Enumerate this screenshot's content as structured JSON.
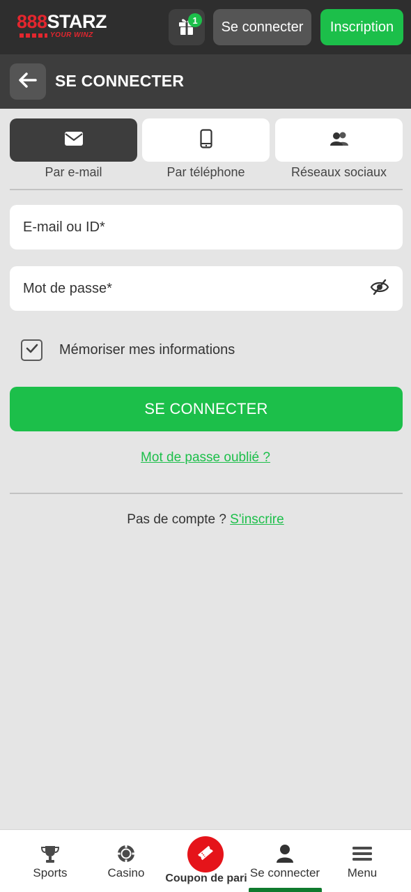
{
  "colors": {
    "accent_green": "#1cbf4a",
    "brand_red": "#e3262e",
    "coupon_red": "#e5141a",
    "topbar_bg": "#2e2e2e",
    "header_bg": "#3d3d3d",
    "page_bg": "#e5e5e5"
  },
  "topbar": {
    "logo_num": "888",
    "logo_word": "STARZ",
    "logo_tagline": "YOUR WINZ",
    "gift_icon": "gift-icon",
    "gift_badge": "1",
    "login_label": "Se connecter",
    "signup_label": "Inscription"
  },
  "header": {
    "back_icon": "arrow-left-icon",
    "title": "SE CONNECTER"
  },
  "tabs": [
    {
      "icon": "envelope-icon",
      "label": "Par e-mail",
      "active": true
    },
    {
      "icon": "phone-icon",
      "label": "Par téléphone",
      "active": false
    },
    {
      "icon": "people-icon",
      "label": "Réseaux sociaux",
      "active": false
    }
  ],
  "form": {
    "email_placeholder": "E-mail ou ID*",
    "email_value": "",
    "password_placeholder": "Mot de passe*",
    "password_value": "",
    "eye_icon": "eye-slash-icon",
    "remember_label": "Mémoriser mes informations",
    "remember_checked": true,
    "submit_label": "SE CONNECTER",
    "forgot_label": "Mot de passe oublié ?",
    "no_account_text": "Pas de compte ?",
    "signup_link": "S'inscrire"
  },
  "bottom_nav": {
    "items": [
      {
        "icon": "trophy-icon",
        "label": "Sports"
      },
      {
        "icon": "casino-chip-icon",
        "label": "Casino"
      },
      {
        "icon": "ticket-icon",
        "label": "Coupon de pari"
      },
      {
        "icon": "user-icon",
        "label": "Se connecter",
        "active": true
      },
      {
        "icon": "hamburger-menu-icon",
        "label": "Menu"
      }
    ]
  }
}
